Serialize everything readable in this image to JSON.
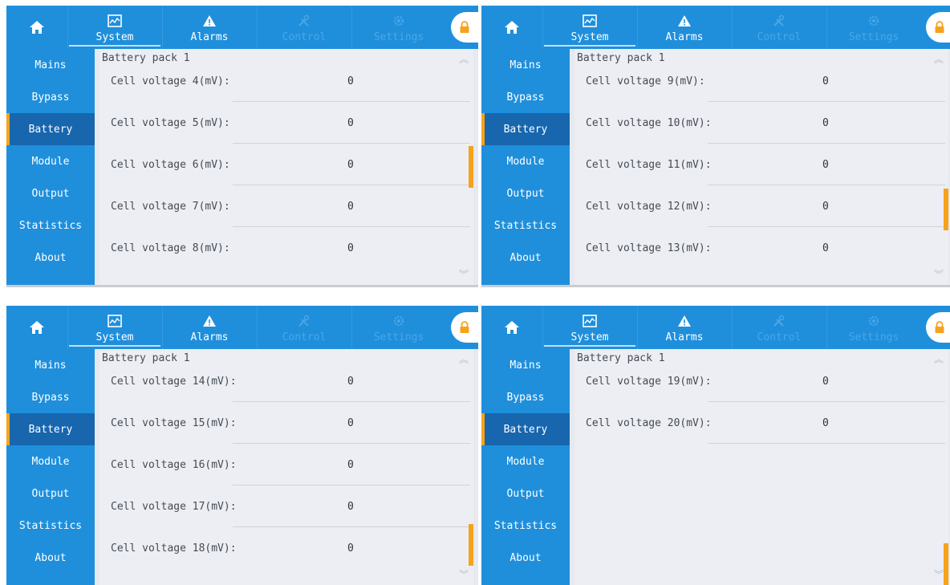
{
  "colors": {
    "bar": "#1f8fdc",
    "active": "#1766ae",
    "accent": "#f7a21b",
    "content_bg": "#eceef3"
  },
  "tabs": {
    "system": "System",
    "alarms": "Alarms",
    "control": "Control",
    "settings": "Settings"
  },
  "sidebar": {
    "items": [
      "Mains",
      "Bypass",
      "Battery",
      "Module",
      "Output",
      "Statistics",
      "About"
    ],
    "active": "Battery"
  },
  "screens": [
    {
      "title": "Battery pack 1",
      "scroll_position": 0.5,
      "rows": [
        {
          "label": "Cell voltage 4(mV):",
          "value": "0"
        },
        {
          "label": "Cell voltage 5(mV):",
          "value": "0"
        },
        {
          "label": "Cell voltage 6(mV):",
          "value": "0"
        },
        {
          "label": "Cell voltage 7(mV):",
          "value": "0"
        },
        {
          "label": "Cell voltage 8(mV):",
          "value": "0"
        }
      ]
    },
    {
      "title": "Battery pack 1",
      "scroll_position": 0.72,
      "rows": [
        {
          "label": "Cell voltage 9(mV):",
          "value": "0"
        },
        {
          "label": "Cell voltage 10(mV):",
          "value": "0"
        },
        {
          "label": "Cell voltage 11(mV):",
          "value": "0"
        },
        {
          "label": "Cell voltage 12(mV):",
          "value": "0"
        },
        {
          "label": "Cell voltage 13(mV):",
          "value": "0"
        }
      ]
    },
    {
      "title": "Battery pack 1",
      "scroll_position": 0.9,
      "rows": [
        {
          "label": "Cell voltage 14(mV):",
          "value": "0"
        },
        {
          "label": "Cell voltage 15(mV):",
          "value": "0"
        },
        {
          "label": "Cell voltage 16(mV):",
          "value": "0"
        },
        {
          "label": "Cell voltage 17(mV):",
          "value": "0"
        },
        {
          "label": "Cell voltage 18(mV):",
          "value": "0"
        }
      ]
    },
    {
      "title": "Battery pack 1",
      "scroll_position": 1.0,
      "rows": [
        {
          "label": "Cell voltage 19(mV):",
          "value": "0"
        },
        {
          "label": "Cell voltage 20(mV):",
          "value": "0"
        }
      ]
    }
  ]
}
